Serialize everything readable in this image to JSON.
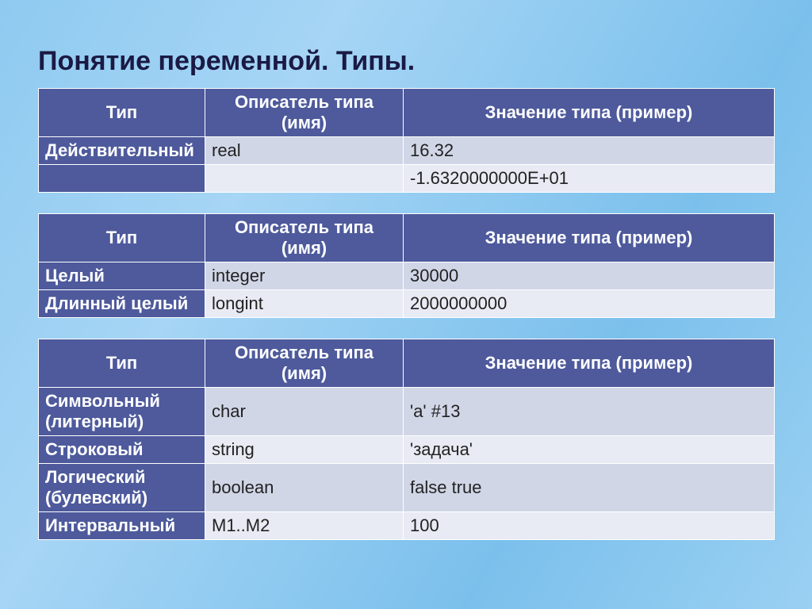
{
  "title": "Понятие переменной. Типы.",
  "headers": {
    "type": "Тип",
    "descriptor": "Описатель типа (имя)",
    "example": "Значение типа (пример)"
  },
  "table1": {
    "rows": [
      {
        "type": "Действительный",
        "descriptor": "real",
        "example": "16.32"
      },
      {
        "type": "",
        "descriptor": "",
        "example": "-1.6320000000E+01"
      }
    ]
  },
  "table2": {
    "rows": [
      {
        "type": "Целый",
        "descriptor": "integer",
        "example": "30000"
      },
      {
        "type": "Длинный целый",
        "descriptor": "longint",
        "example": "2000000000"
      }
    ]
  },
  "table3": {
    "rows": [
      {
        "type": "Символьный (литерный)",
        "descriptor": "char",
        "example": "'a' #13"
      },
      {
        "type": "Строковый",
        "descriptor": "string",
        "example": "'задача'"
      },
      {
        "type": "Логический (булевский)",
        "descriptor": "boolean",
        "example": "false true"
      },
      {
        "type": "Интервальный",
        "descriptor": "M1..M2",
        "example": "100"
      }
    ]
  }
}
